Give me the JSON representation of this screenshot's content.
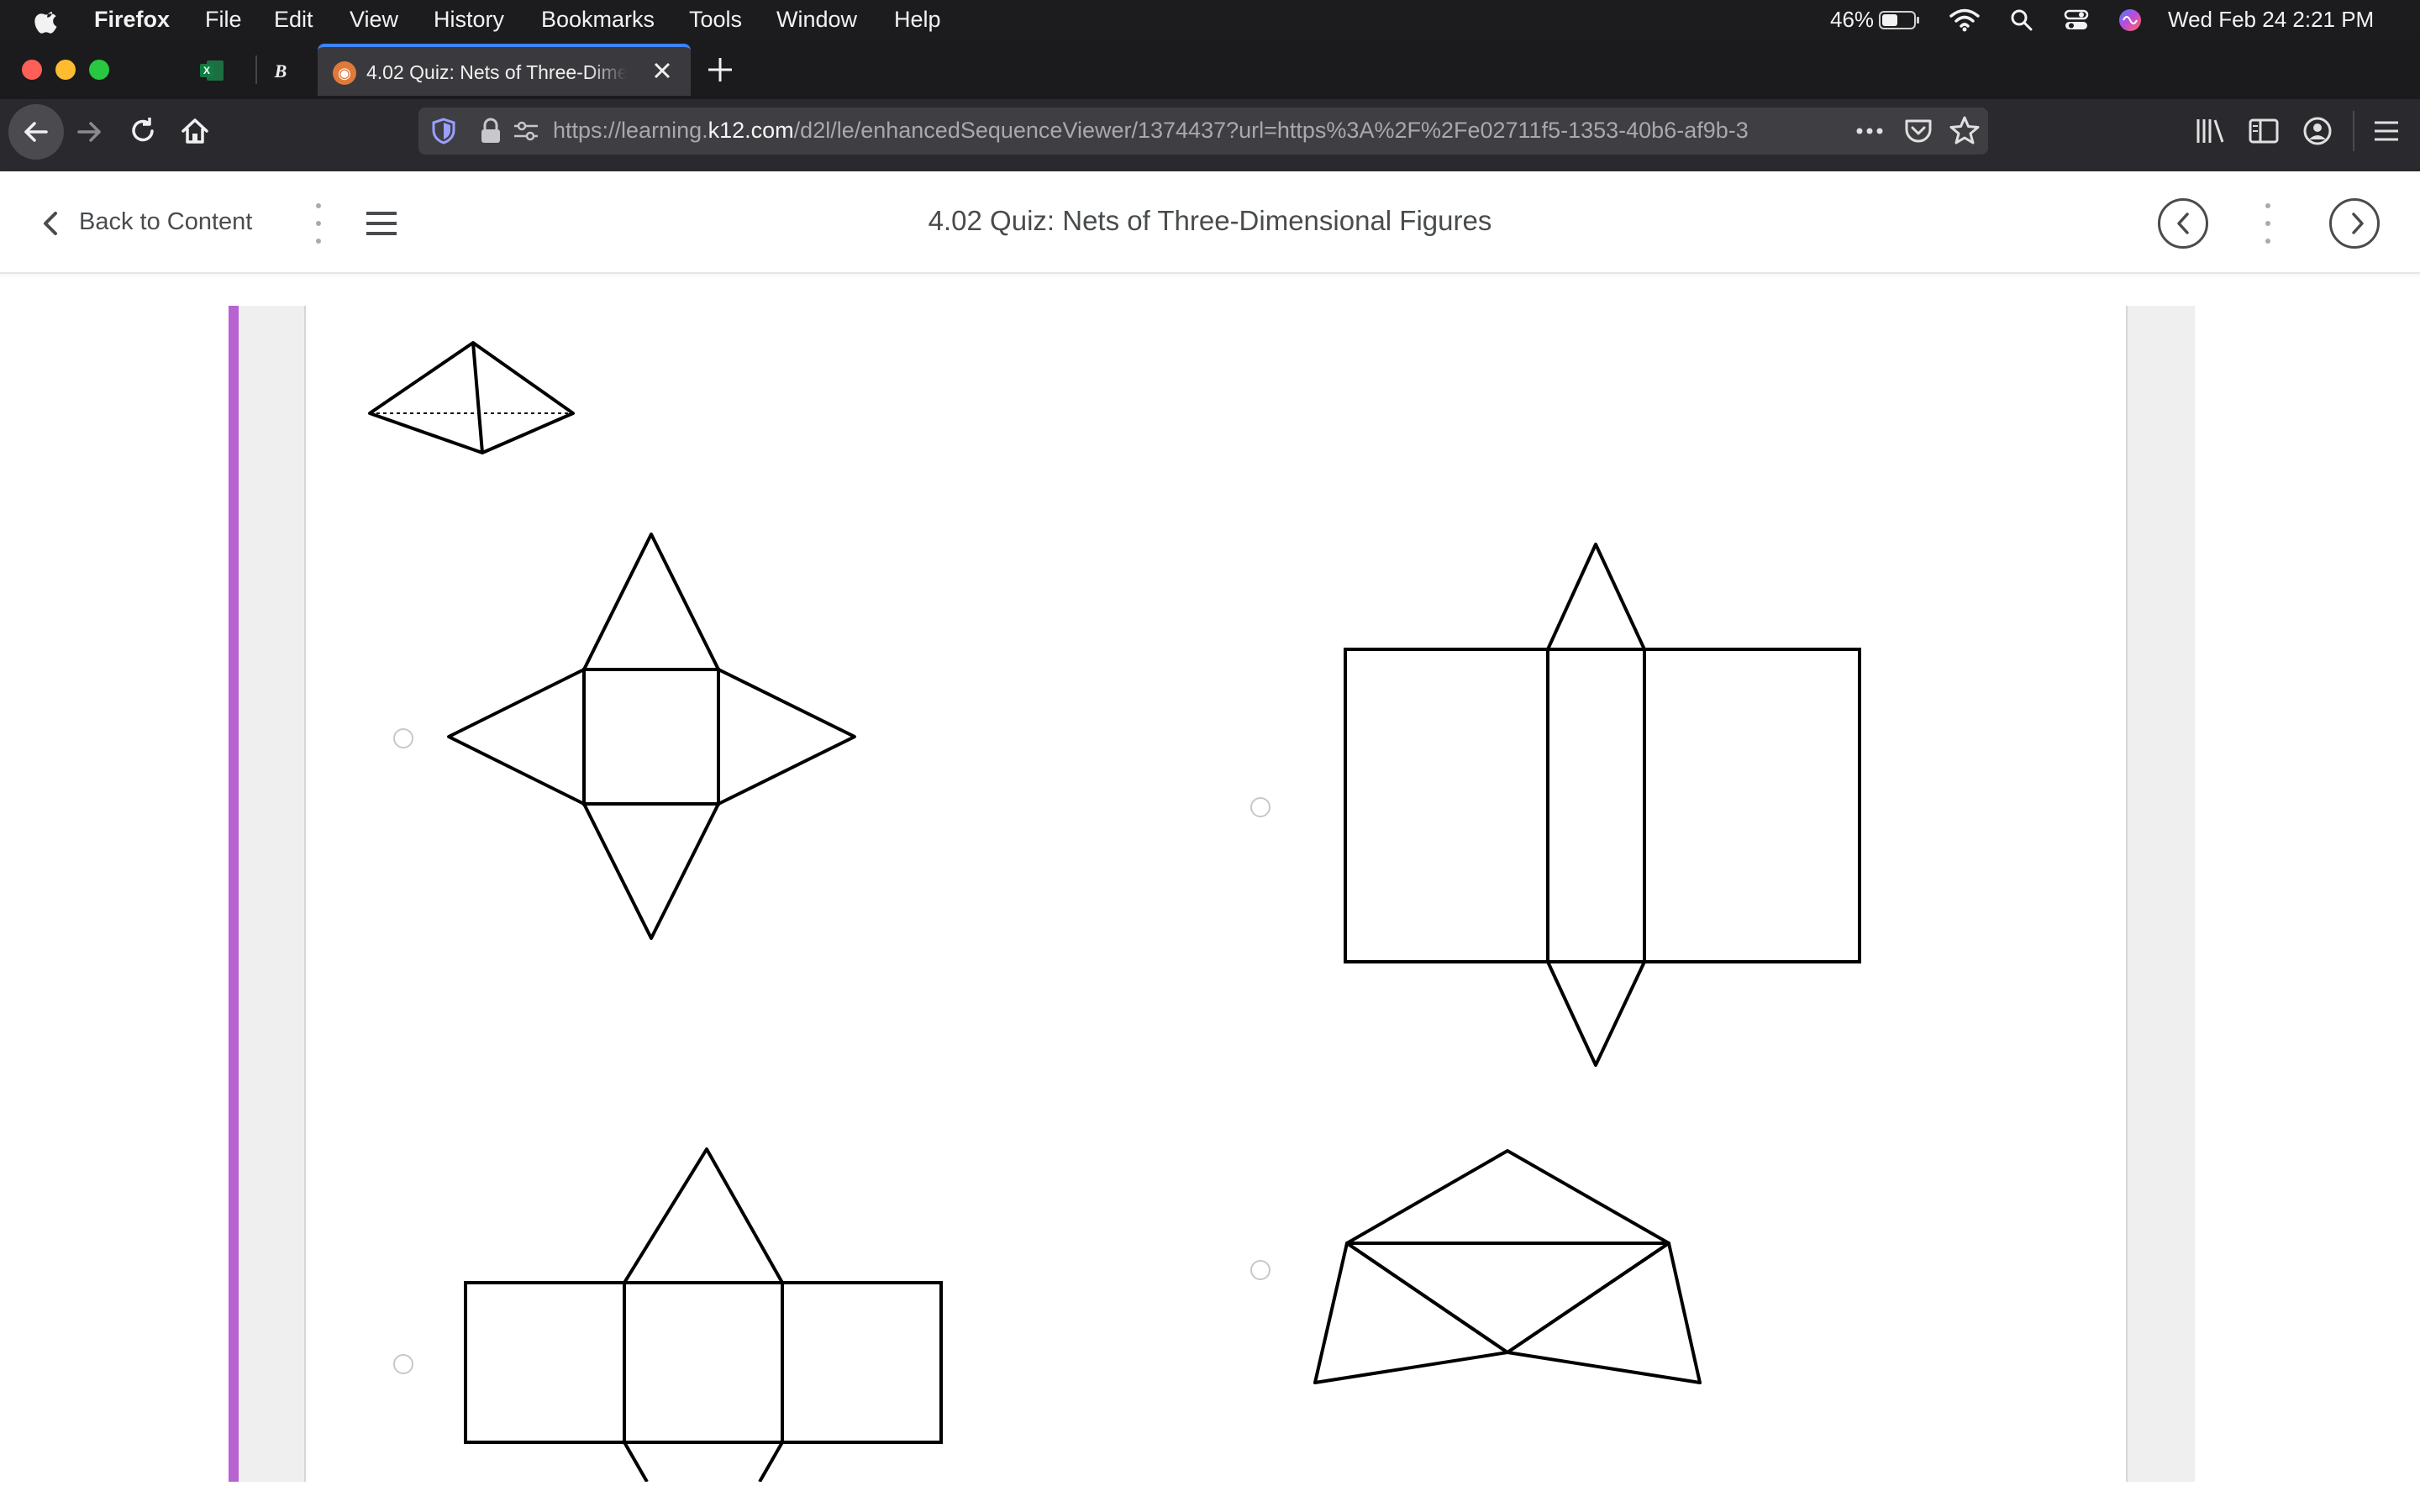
{
  "menubar": {
    "app_name": "Firefox",
    "items": [
      "File",
      "Edit",
      "View",
      "History",
      "Bookmarks",
      "Tools",
      "Window",
      "Help"
    ],
    "battery": "46%",
    "datetime": "Wed Feb 24  2:21 PM"
  },
  "browser": {
    "active_tab_title": "4.02 Quiz: Nets of Three-Dimensional Figures",
    "url_prefix": "https://learning.",
    "url_domain": "k12.com",
    "url_rest": "/d2l/le/enhancedSequenceViewer/1374437?url=https%3A%2F%2Fe02711f5-1353-40b6-af9b-3",
    "new_tab_symbol": "+"
  },
  "content_header": {
    "back_label": "Back to Content",
    "title": "4.02 Quiz: Nets of Three-Dimensional Figures"
  },
  "colors": {
    "accent_bar": "#b962d2",
    "tab_highlight": "#3d83f5",
    "text": "#494c4e"
  },
  "quiz": {
    "figure": "square-pyramid",
    "options": [
      {
        "id": "a",
        "net": "square-with-four-triangles",
        "selected": false
      },
      {
        "id": "b",
        "net": "three-rectangles-two-triangles",
        "selected": false
      },
      {
        "id": "c",
        "net": "three-squares-two-triangles",
        "selected": false
      },
      {
        "id": "d",
        "net": "four-triangles",
        "selected": false
      }
    ]
  }
}
